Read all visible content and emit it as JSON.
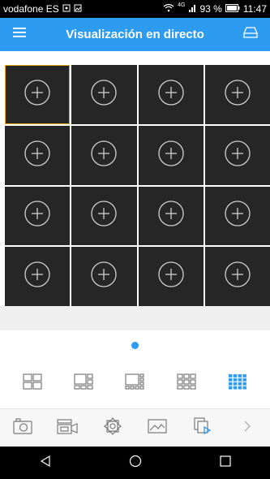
{
  "status_bar": {
    "carrier": "vodafone ES",
    "network_type": "4G",
    "battery": "93 %",
    "time": "11:47"
  },
  "app_bar": {
    "title": "Visualización en directo"
  },
  "colors": {
    "accent": "#2d9bf0",
    "selected_border": "#e6a817",
    "tile_background": "#262626"
  },
  "grid": {
    "rows": 4,
    "columns": 4,
    "selected_index": 0,
    "tile_icon": "add-circle-icon"
  },
  "pager": {
    "pages": 1,
    "current": 1
  },
  "layouts": [
    {
      "icon": "layout-4-icon",
      "active": false
    },
    {
      "icon": "layout-6-icon",
      "active": false
    },
    {
      "icon": "layout-8-icon",
      "active": false
    },
    {
      "icon": "layout-9-icon",
      "active": false
    },
    {
      "icon": "layout-16-icon",
      "active": true
    }
  ],
  "toolbar": [
    {
      "icon": "snapshot-icon"
    },
    {
      "icon": "record-icon"
    },
    {
      "icon": "ptz-icon"
    },
    {
      "icon": "image-icon"
    },
    {
      "icon": "playback-icon"
    },
    {
      "icon": "next-arrow-icon"
    }
  ],
  "nav_bar": [
    {
      "icon": "back-icon"
    },
    {
      "icon": "home-icon"
    },
    {
      "icon": "recents-icon"
    }
  ]
}
